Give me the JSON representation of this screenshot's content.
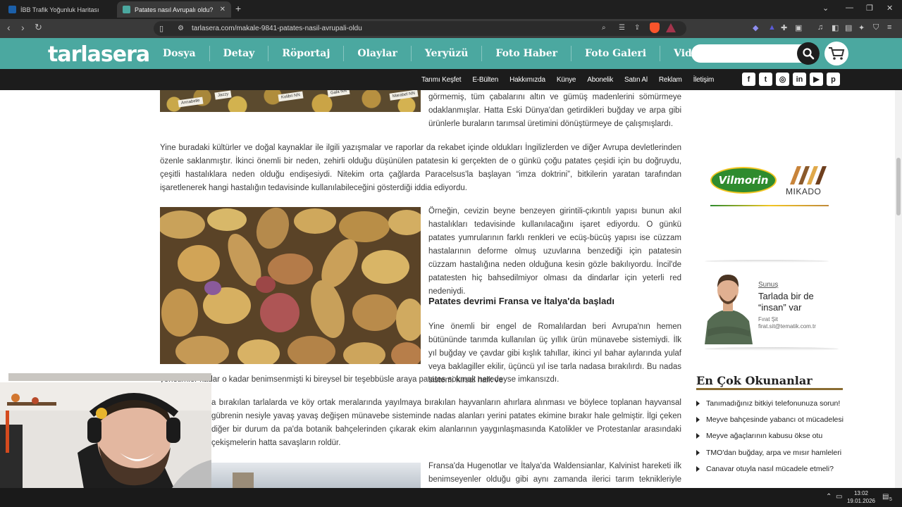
{
  "browser": {
    "tabs": [
      {
        "title": "İBB Trafik Yoğunluk Haritası",
        "active": false
      },
      {
        "title": "Patates nasıl Avrupalı oldu? | tar",
        "active": true
      }
    ],
    "new_tab": "+",
    "url": "tarlasera.com/makale-9841-patates-nasil-avrupali-oldu",
    "win_minimize": "⌄",
    "win_min": "—",
    "win_restore": "❐",
    "win_close": "✕"
  },
  "site": {
    "logo": "tarlasera",
    "main_nav": [
      "Dosya",
      "Detay",
      "Röportaj",
      "Olaylar",
      "Yeryüzü",
      "Foto Haber",
      "Foto Galeri",
      "Video"
    ],
    "sub_nav": [
      "Tarımı Keşfet",
      "E-Bülten",
      "Hakkımızda",
      "Künye",
      "Abonelik",
      "Satın Al",
      "Reklam",
      "İletişim"
    ],
    "social_icons": [
      "facebook-icon",
      "twitter-icon",
      "instagram-icon",
      "linkedin-icon",
      "youtube-icon",
      "pinterest-icon"
    ],
    "search_placeholder": "",
    "accent": "#4ba8a0"
  },
  "article": {
    "image1_tags": [
      "Kolibri NN",
      "Annabelle",
      "Jazzy",
      "Gala NN",
      "Marabel NN"
    ],
    "p1": "görmemiş, tüm çabalarını altın ve gümüş madenlerini sömürmeye odaklanmışlar. Hatta Eski Dünya'dan getirdikleri buğday ve arpa gibi ürünlerle buraların tarımsal üretimini dönüştürmeye de çalışmışlardı.",
    "p2": "Yine buradaki kültürler ve doğal kaynaklar ile ilgili yazışmalar ve raporlar da rekabet içinde oldukları İngilizlerden ve diğer Avrupa devletlerinden özenle saklanmıştır. İkinci önemli bir neden, zehirli olduğu düşünülen patatesin ki gerçekten de o günkü çoğu patates çeşidi için bu doğruydu, çeşitli hastalıklara neden olduğu endişesiydi. Nitekim orta çağlarda Paracelsus'la başlayan “imza doktrini”, bitkilerin yaratan tarafından işaretlenerek hangi hastalığın tedavisinde kullanılabileceğini gösterdiği iddia ediyordu.",
    "p3": "Örneğin, cevizin beyne benzeyen girintili-çıkıntılı yapısı bunun akıl hastalıkları tedavisinde kullanılacağını işaret ediyordu. O günkü patates yumrularının farklı renkleri ve ecüş-bücüş yapısı ise cüzzam hastalarının deforme olmuş uzuvlarına benzediği için patatesin cüzzam hastalığına neden olduğuna kesin gözle bakılıyordu. İncil'de patatesten hiç bahsedilmiyor olması da dindarlar için yeterli red nedeniydi.",
    "heading": "Patates devrimi Fransa ve İtalya'da başladı",
    "p4a": "Yine önemli bir engel de Romalılardan beri Avrupa'nın hemen bütününde tarımda kullanılan üç yıllık ürün münavebe sistemiydi. İlk yıl buğday ve çavdar gibi kışlık tahıllar, ikinci yıl bahar aylarında yulaf veya baklagiller ekilir, üçüncü yıl ise tarla nadasa bırakılırdı. Bu nadas sistemi kırsal halk ve",
    "p4b": "yönetimler kadar o kadar benimsenmişti ki bireysel bir teşebbüsle araya patates sokmak neredeyse imkansızdı.",
    "p5": "a bırakılan tarlalarda ve köy ortak meralarında yayılmaya bırakılan hayvanların ahırlara alınması ve böylece toplanan hayvansal gübrenin nesiyle yavaş yavaş değişen münavebe sisteminde nadas alanları yerini patates ekimine bırakır hale gelmiştir. İlgi çeken diğer bir durum da pa'da botanik bahçelerinden çıkarak ekim alanlarının yaygınlaşmasında Katolikler ve Protestanlar arasındaki çekişmelerin hatta savaşların roldür.",
    "p6": "Fransa'da Hugenotlar ve İtalya'da Waldensianlar, Kalvinist hareketi ilk benimseyenler olduğu gibi aynı zamanda ilerici tarım teknikleriyle patates"
  },
  "sidebar": {
    "ad_brand1": "Vilmorin",
    "ad_brand2": "MIKADO",
    "promo_label": "Sunuş",
    "promo_title": "Tarlada bir de “insan” var",
    "promo_name": "Fırat Şit",
    "promo_email": "firat.sit@tematik.com.tr",
    "popular_title": "En Çok Okunanlar",
    "popular_items": [
      "Tanımadığınız bitkiyi telefonunuza sorun!",
      "Meyve bahçesinde yabancı ot mücadelesi",
      "Meyve ağaçlarının kabusu ökse otu",
      "TMO'dan buğday, arpa ve mısır hamleleri",
      "Canavar otuyla nasıl mücadele etmeli?"
    ]
  },
  "taskbar": {
    "time": "13:02",
    "date": "19.01.2026",
    "notification_count": "5"
  }
}
